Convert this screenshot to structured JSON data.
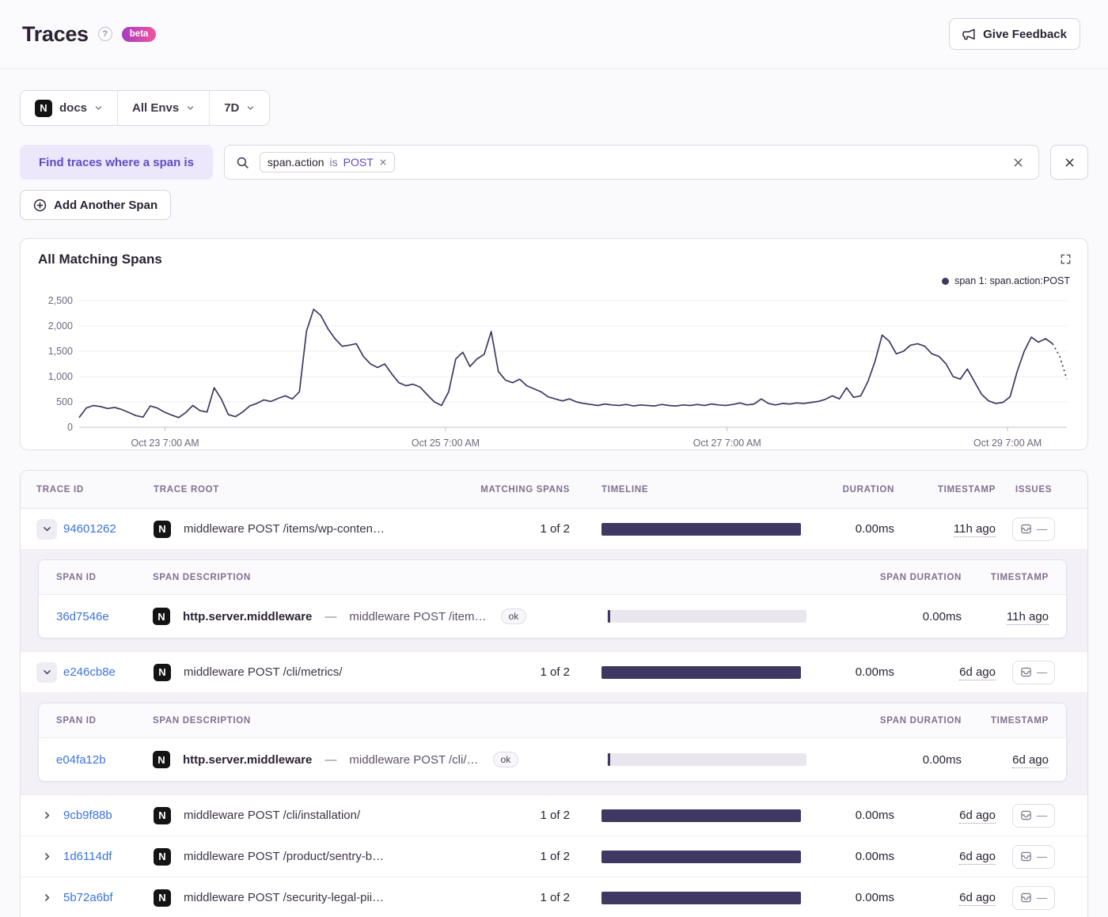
{
  "colors": {
    "accent_purple": "#6349C7",
    "chip_bg": "#ECE7FB",
    "link_blue": "#3D74DB",
    "bar_navy": "#3E3862",
    "badge_gradient_start": "#A83ABF",
    "badge_gradient_end": "#F0569E"
  },
  "page": {
    "title": "Traces",
    "beta_label": "beta"
  },
  "header": {
    "feedback_label": "Give Feedback"
  },
  "filters": {
    "project": "docs",
    "env": "All Envs",
    "period": "7D"
  },
  "query": {
    "find_label": "Find traces where a span is",
    "token": {
      "key": "span.action",
      "op": "is",
      "value": "POST"
    },
    "add_span_label": "Add Another Span"
  },
  "chart_data": {
    "type": "line",
    "title": "All Matching Spans",
    "legend": [
      {
        "label": "span 1: span.action:POST",
        "color": "#3E3862"
      }
    ],
    "legend_position": "top-right",
    "grid": "horizontal",
    "ylim": [
      0,
      2500
    ],
    "y_ticks": [
      0,
      500,
      1000,
      1500,
      2000,
      2500
    ],
    "y_tick_labels": [
      "0",
      "500",
      "1,000",
      "1,500",
      "2,000",
      "2,500"
    ],
    "x_ticks": [
      {
        "label": "Oct 23 7:00 AM",
        "pos": 0.087
      },
      {
        "label": "Oct 25 7:00 AM",
        "pos": 0.371
      },
      {
        "label": "Oct 27 7:00 AM",
        "pos": 0.656
      },
      {
        "label": "Oct 29 7:00 AM",
        "pos": 0.94
      }
    ],
    "line_color": "#3E3862",
    "dashed_tail_points": 3,
    "values": [
      190,
      380,
      430,
      410,
      370,
      390,
      350,
      290,
      230,
      200,
      420,
      380,
      300,
      240,
      190,
      290,
      430,
      330,
      300,
      780,
      560,
      250,
      210,
      300,
      420,
      470,
      540,
      510,
      570,
      620,
      560,
      700,
      1900,
      2330,
      2210,
      1950,
      1750,
      1600,
      1620,
      1650,
      1400,
      1250,
      1180,
      1250,
      1050,
      880,
      820,
      850,
      790,
      640,
      500,
      430,
      700,
      1350,
      1480,
      1200,
      1350,
      1440,
      1890,
      1100,
      930,
      880,
      950,
      820,
      760,
      700,
      600,
      560,
      520,
      560,
      500,
      470,
      450,
      430,
      460,
      440,
      430,
      450,
      420,
      440,
      430,
      420,
      450,
      430,
      420,
      440,
      430,
      450,
      430,
      460,
      440,
      430,
      450,
      480,
      440,
      460,
      560,
      470,
      440,
      470,
      460,
      480,
      470,
      490,
      510,
      550,
      620,
      560,
      780,
      590,
      620,
      900,
      1300,
      1820,
      1700,
      1450,
      1500,
      1620,
      1650,
      1600,
      1450,
      1400,
      1250,
      1000,
      950,
      1150,
      900,
      650,
      520,
      470,
      490,
      600,
      1100,
      1500,
      1780,
      1680,
      1750,
      1650,
      1400,
      950
    ]
  },
  "table": {
    "headers": {
      "trace_id": "TRACE ID",
      "trace_root": "TRACE ROOT",
      "matching": "MATCHING SPANS",
      "timeline": "TIMELINE",
      "duration": "DURATION",
      "timestamp": "TIMESTAMP",
      "issues": "ISSUES"
    },
    "span_headers": {
      "span_id": "SPAN ID",
      "span_description": "SPAN DESCRIPTION",
      "span_duration": "SPAN DURATION",
      "timestamp": "TIMESTAMP"
    },
    "issues_placeholder": "—",
    "rows": [
      {
        "expanded": true,
        "trace_id": "94601262",
        "root": "middleware POST /items/wp-conten…",
        "matching": "1 of 2",
        "duration": "0.00ms",
        "timestamp": "11h ago",
        "spans": [
          {
            "span_id": "36d7546e",
            "op": "http.server.middleware",
            "separator": "—",
            "description": "middleware POST /item…",
            "status": "ok",
            "duration": "0.00ms",
            "timestamp": "11h ago"
          }
        ]
      },
      {
        "expanded": true,
        "trace_id": "e246cb8e",
        "root": "middleware POST /cli/metrics/",
        "matching": "1 of 2",
        "duration": "0.00ms",
        "timestamp": "6d ago",
        "spans": [
          {
            "span_id": "e04fa12b",
            "op": "http.server.middleware",
            "separator": "—",
            "description": "middleware POST /cli/…",
            "status": "ok",
            "duration": "0.00ms",
            "timestamp": "6d ago"
          }
        ]
      },
      {
        "expanded": false,
        "trace_id": "9cb9f88b",
        "root": "middleware POST /cli/installation/",
        "matching": "1 of 2",
        "duration": "0.00ms",
        "timestamp": "6d ago",
        "spans": []
      },
      {
        "expanded": false,
        "trace_id": "1d6114df",
        "root": "middleware POST /product/sentry-b…",
        "matching": "1 of 2",
        "duration": "0.00ms",
        "timestamp": "6d ago",
        "spans": []
      },
      {
        "expanded": false,
        "trace_id": "5b72a6bf",
        "root": "middleware POST /security-legal-pii…",
        "matching": "1 of 2",
        "duration": "0.00ms",
        "timestamp": "6d ago",
        "spans": []
      }
    ]
  }
}
